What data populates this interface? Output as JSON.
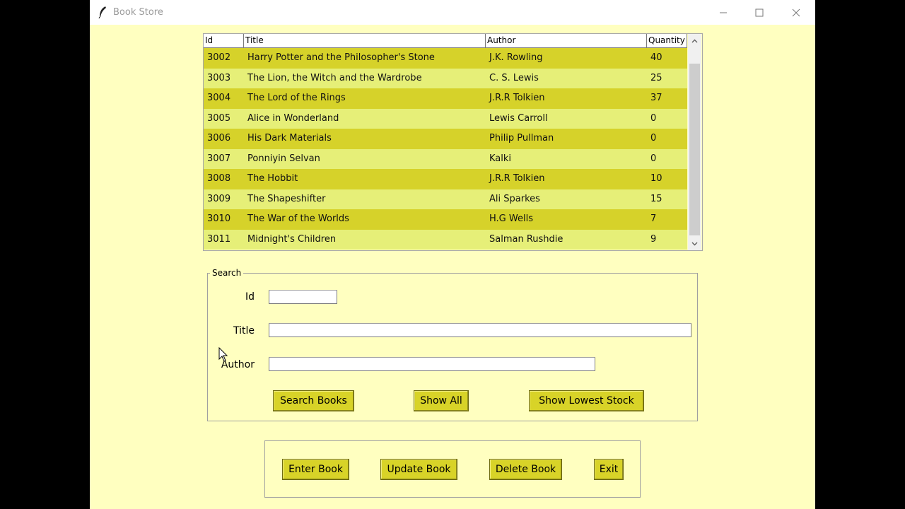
{
  "window": {
    "title": "Book Store",
    "icon": "feather-icon"
  },
  "table": {
    "columns": [
      "Id",
      "Title",
      "Author",
      "Quantity"
    ],
    "rows": [
      [
        "3002",
        "Harry Potter and the Philosopher's Stone",
        "J.K. Rowling",
        "40"
      ],
      [
        "3003",
        "The Lion, the Witch and the Wardrobe",
        "C. S. Lewis",
        "25"
      ],
      [
        "3004",
        "The Lord of the Rings",
        "J.R.R Tolkien",
        "37"
      ],
      [
        "3005",
        "Alice in Wonderland",
        "Lewis Carroll",
        "0"
      ],
      [
        "3006",
        "His Dark Materials",
        "Philip Pullman",
        "0"
      ],
      [
        "3007",
        "Ponniyin Selvan",
        "Kalki",
        "0"
      ],
      [
        "3008",
        "The Hobbit",
        "J.R.R Tolkien",
        "10"
      ],
      [
        "3009",
        "The Shapeshifter",
        "Ali Sparkes",
        "15"
      ],
      [
        "3010",
        "The War of the Worlds",
        "H.G Wells",
        "7"
      ],
      [
        "3011",
        "Midnight's Children",
        "Salman Rushdie",
        "9"
      ]
    ]
  },
  "search": {
    "legend": "Search",
    "id_label": "Id",
    "title_label": "Title",
    "author_label": "Author",
    "id_value": "",
    "title_value": "",
    "author_value": "",
    "search_button": "Search Books",
    "show_all_button": "Show All",
    "lowest_stock_button": "Show Lowest Stock"
  },
  "actions": {
    "enter_button": "Enter Book",
    "update_button": "Update Book",
    "delete_button": "Delete Book",
    "exit_button": "Exit"
  },
  "colors": {
    "background": "#ffffc0",
    "row_odd": "#d6d22a",
    "row_even": "#e6ef78",
    "button": "#d8d328"
  }
}
